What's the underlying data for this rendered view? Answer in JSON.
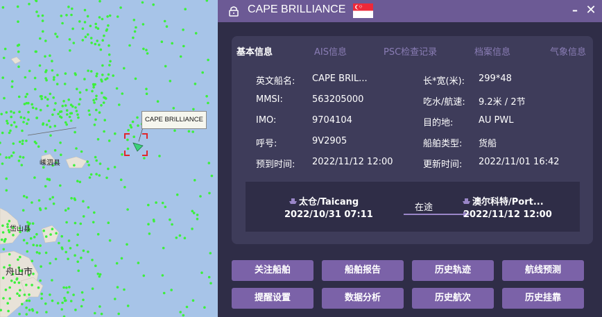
{
  "map": {
    "ship_tag": "CAPE BRILLIANCE",
    "labels": [
      "嵊泗县",
      "岱山县",
      "舟山市"
    ]
  },
  "panel": {
    "title": "CAPE BRILLIANCE",
    "flag_country": "Singapore",
    "tabs": [
      "基本信息",
      "AIS信息",
      "PSC检查记录",
      "档案信息",
      "气象信息"
    ],
    "active_tab": "基本信息",
    "fields": {
      "name_en_label": "英文船名:",
      "name_en_value": "CAPE BRIL...",
      "mmsi_label": "MMSI:",
      "mmsi_value": "563205000",
      "imo_label": "IMO:",
      "imo_value": "9704104",
      "callsign_label": "呼号:",
      "callsign_value": "9V2905",
      "eta_label": "预到时间:",
      "eta_value": "2022/11/12 12:00",
      "size_label": "长*宽(米):",
      "size_value": "299*48",
      "draft_label": "吃水/航速:",
      "draft_value": "9.2米 / 2节",
      "dest_label": "目的地:",
      "dest_value": "AU PWL",
      "type_label": "船舶类型:",
      "type_value": "货船",
      "updated_label": "更新时间:",
      "updated_value": "2022/11/01 16:42"
    },
    "voyage": {
      "from_port": "太仓/Taicang",
      "from_time": "2022/10/31 07:11",
      "status": "在途",
      "to_port": "澳尔科特/Port...",
      "to_time": "2022/11/12 12:00"
    },
    "buttons": [
      "关注船舶",
      "船舶报告",
      "历史轨迹",
      "航线预测",
      "提醒设置",
      "数据分析",
      "历史航次",
      "历史挂靠"
    ]
  },
  "colors": {
    "sea": "#a7c4e8",
    "land": "#e8e2d8",
    "ship_dot": "#3cf03c",
    "panel_bg": "#2f2d47",
    "header_bg": "#6c5a95",
    "card_bg": "#3e3c5a",
    "button_bg": "#7b62a8",
    "tab_inactive": "#8a7db5",
    "selection_red": "#e0262a"
  }
}
